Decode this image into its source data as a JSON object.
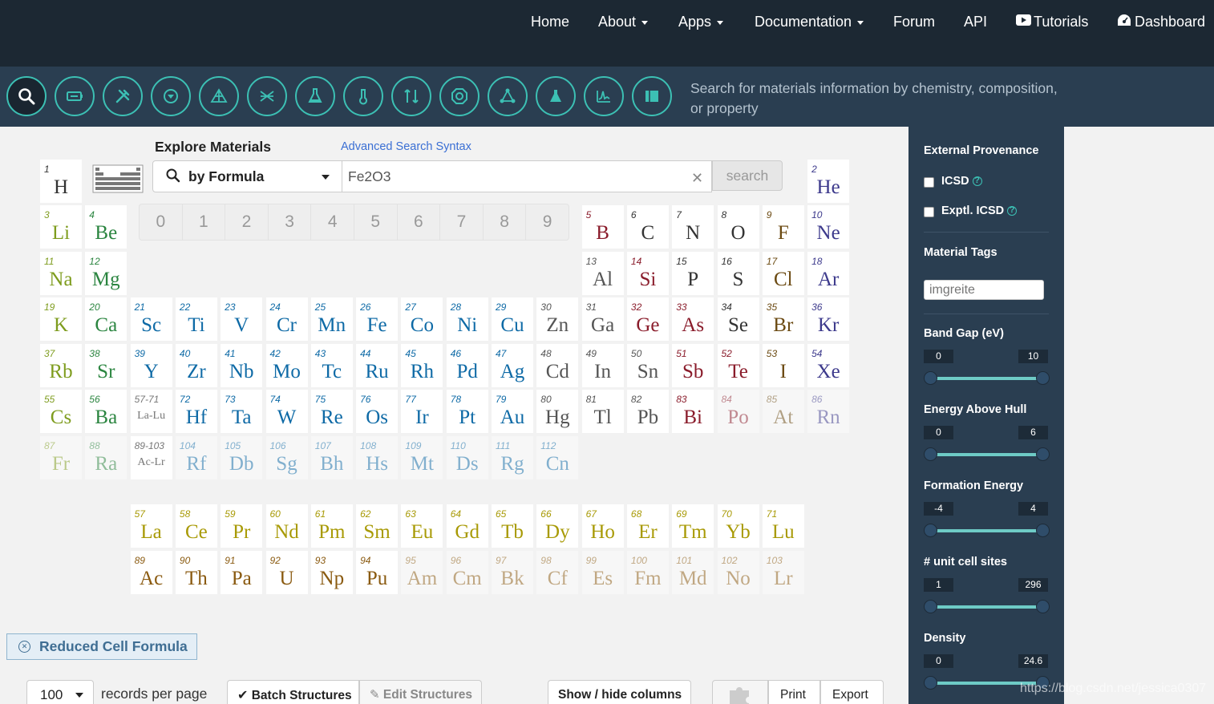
{
  "nav": {
    "home": "Home",
    "about": "About",
    "apps": "Apps",
    "documentation": "Documentation",
    "forum": "Forum",
    "api": "API",
    "tutorials": "Tutorials",
    "dashboard": "Dashboard"
  },
  "toolbar": {
    "tagline": "Search for materials information by chemistry, composition, or property",
    "icons": [
      "search-icon",
      "battery-icon",
      "tools-icon",
      "pourquoi-icon",
      "phase-diagram-icon",
      "crystal-icon",
      "flask-icon",
      "thermometer-icon",
      "reaction-icon",
      "nanoparticle-icon",
      "molecule-icon",
      "chemistry-icon",
      "spectrum-icon",
      "database-icon"
    ]
  },
  "search": {
    "heading": "Explore Materials",
    "advanced_link": "Advanced Search Syntax",
    "mode": "by Formula",
    "value": "Fe2O3",
    "button": "search",
    "digits": [
      "0",
      "1",
      "2",
      "3",
      "4",
      "5",
      "6",
      "7",
      "8",
      "9"
    ]
  },
  "periodic_table": {
    "elements": [
      {
        "n": "1",
        "s": "H",
        "c": "nonmetal",
        "g": 1,
        "p": 1
      },
      {
        "n": "2",
        "s": "He",
        "c": "noble",
        "g": 18,
        "p": 1
      },
      {
        "n": "3",
        "s": "Li",
        "c": "alkali",
        "g": 1,
        "p": 2
      },
      {
        "n": "4",
        "s": "Be",
        "c": "alkaline",
        "g": 2,
        "p": 2
      },
      {
        "n": "5",
        "s": "B",
        "c": "metalloid",
        "g": 13,
        "p": 2
      },
      {
        "n": "6",
        "s": "C",
        "c": "nonmetal",
        "g": 14,
        "p": 2
      },
      {
        "n": "7",
        "s": "N",
        "c": "nonmetal",
        "g": 15,
        "p": 2
      },
      {
        "n": "8",
        "s": "O",
        "c": "nonmetal",
        "g": 16,
        "p": 2
      },
      {
        "n": "9",
        "s": "F",
        "c": "halogen",
        "g": 17,
        "p": 2
      },
      {
        "n": "10",
        "s": "Ne",
        "c": "noble",
        "g": 18,
        "p": 2
      },
      {
        "n": "11",
        "s": "Na",
        "c": "alkali",
        "g": 1,
        "p": 3
      },
      {
        "n": "12",
        "s": "Mg",
        "c": "alkaline",
        "g": 2,
        "p": 3
      },
      {
        "n": "13",
        "s": "Al",
        "c": "post",
        "g": 13,
        "p": 3
      },
      {
        "n": "14",
        "s": "Si",
        "c": "metalloid",
        "g": 14,
        "p": 3
      },
      {
        "n": "15",
        "s": "P",
        "c": "nonmetal",
        "g": 15,
        "p": 3
      },
      {
        "n": "16",
        "s": "S",
        "c": "nonmetal",
        "g": 16,
        "p": 3
      },
      {
        "n": "17",
        "s": "Cl",
        "c": "halogen",
        "g": 17,
        "p": 3
      },
      {
        "n": "18",
        "s": "Ar",
        "c": "noble",
        "g": 18,
        "p": 3
      },
      {
        "n": "19",
        "s": "K",
        "c": "alkali",
        "g": 1,
        "p": 4
      },
      {
        "n": "20",
        "s": "Ca",
        "c": "alkaline",
        "g": 2,
        "p": 4
      },
      {
        "n": "21",
        "s": "Sc",
        "c": "transition",
        "g": 3,
        "p": 4
      },
      {
        "n": "22",
        "s": "Ti",
        "c": "transition",
        "g": 4,
        "p": 4
      },
      {
        "n": "23",
        "s": "V",
        "c": "transition",
        "g": 5,
        "p": 4
      },
      {
        "n": "24",
        "s": "Cr",
        "c": "transition",
        "g": 6,
        "p": 4
      },
      {
        "n": "25",
        "s": "Mn",
        "c": "transition",
        "g": 7,
        "p": 4
      },
      {
        "n": "26",
        "s": "Fe",
        "c": "transition",
        "g": 8,
        "p": 4
      },
      {
        "n": "27",
        "s": "Co",
        "c": "transition",
        "g": 9,
        "p": 4
      },
      {
        "n": "28",
        "s": "Ni",
        "c": "transition",
        "g": 10,
        "p": 4
      },
      {
        "n": "29",
        "s": "Cu",
        "c": "transition",
        "g": 11,
        "p": 4
      },
      {
        "n": "30",
        "s": "Zn",
        "c": "post",
        "g": 12,
        "p": 4
      },
      {
        "n": "31",
        "s": "Ga",
        "c": "post",
        "g": 13,
        "p": 4
      },
      {
        "n": "32",
        "s": "Ge",
        "c": "metalloid",
        "g": 14,
        "p": 4
      },
      {
        "n": "33",
        "s": "As",
        "c": "metalloid",
        "g": 15,
        "p": 4
      },
      {
        "n": "34",
        "s": "Se",
        "c": "nonmetal",
        "g": 16,
        "p": 4
      },
      {
        "n": "35",
        "s": "Br",
        "c": "halogen",
        "g": 17,
        "p": 4
      },
      {
        "n": "36",
        "s": "Kr",
        "c": "noble",
        "g": 18,
        "p": 4
      },
      {
        "n": "37",
        "s": "Rb",
        "c": "alkali",
        "g": 1,
        "p": 5
      },
      {
        "n": "38",
        "s": "Sr",
        "c": "alkaline",
        "g": 2,
        "p": 5
      },
      {
        "n": "39",
        "s": "Y",
        "c": "transition",
        "g": 3,
        "p": 5
      },
      {
        "n": "40",
        "s": "Zr",
        "c": "transition",
        "g": 4,
        "p": 5
      },
      {
        "n": "41",
        "s": "Nb",
        "c": "transition",
        "g": 5,
        "p": 5
      },
      {
        "n": "42",
        "s": "Mo",
        "c": "transition",
        "g": 6,
        "p": 5
      },
      {
        "n": "43",
        "s": "Tc",
        "c": "transition",
        "g": 7,
        "p": 5
      },
      {
        "n": "44",
        "s": "Ru",
        "c": "transition",
        "g": 8,
        "p": 5
      },
      {
        "n": "45",
        "s": "Rh",
        "c": "transition",
        "g": 9,
        "p": 5
      },
      {
        "n": "46",
        "s": "Pd",
        "c": "transition",
        "g": 10,
        "p": 5
      },
      {
        "n": "47",
        "s": "Ag",
        "c": "transition",
        "g": 11,
        "p": 5
      },
      {
        "n": "48",
        "s": "Cd",
        "c": "post",
        "g": 12,
        "p": 5
      },
      {
        "n": "49",
        "s": "In",
        "c": "post",
        "g": 13,
        "p": 5
      },
      {
        "n": "50",
        "s": "Sn",
        "c": "post",
        "g": 14,
        "p": 5
      },
      {
        "n": "51",
        "s": "Sb",
        "c": "metalloid",
        "g": 15,
        "p": 5
      },
      {
        "n": "52",
        "s": "Te",
        "c": "metalloid",
        "g": 16,
        "p": 5
      },
      {
        "n": "53",
        "s": "I",
        "c": "halogen",
        "g": 17,
        "p": 5
      },
      {
        "n": "54",
        "s": "Xe",
        "c": "noble",
        "g": 18,
        "p": 5
      },
      {
        "n": "55",
        "s": "Cs",
        "c": "alkali",
        "g": 1,
        "p": 6
      },
      {
        "n": "56",
        "s": "Ba",
        "c": "alkaline",
        "g": 2,
        "p": 6
      },
      {
        "n": "57-71",
        "s": "La-Lu",
        "c": "range",
        "g": 3,
        "p": 6
      },
      {
        "n": "72",
        "s": "Hf",
        "c": "transition",
        "g": 4,
        "p": 6
      },
      {
        "n": "73",
        "s": "Ta",
        "c": "transition",
        "g": 5,
        "p": 6
      },
      {
        "n": "74",
        "s": "W",
        "c": "transition",
        "g": 6,
        "p": 6
      },
      {
        "n": "75",
        "s": "Re",
        "c": "transition",
        "g": 7,
        "p": 6
      },
      {
        "n": "76",
        "s": "Os",
        "c": "transition",
        "g": 8,
        "p": 6
      },
      {
        "n": "77",
        "s": "Ir",
        "c": "transition",
        "g": 9,
        "p": 6
      },
      {
        "n": "78",
        "s": "Pt",
        "c": "transition",
        "g": 10,
        "p": 6
      },
      {
        "n": "79",
        "s": "Au",
        "c": "transition",
        "g": 11,
        "p": 6
      },
      {
        "n": "80",
        "s": "Hg",
        "c": "post",
        "g": 12,
        "p": 6
      },
      {
        "n": "81",
        "s": "Tl",
        "c": "post",
        "g": 13,
        "p": 6
      },
      {
        "n": "82",
        "s": "Pb",
        "c": "post",
        "g": 14,
        "p": 6
      },
      {
        "n": "83",
        "s": "Bi",
        "c": "metalloid",
        "g": 15,
        "p": 6
      },
      {
        "n": "84",
        "s": "Po",
        "c": "metalloid",
        "g": 16,
        "p": 6,
        "dim": true
      },
      {
        "n": "85",
        "s": "At",
        "c": "halogen",
        "g": 17,
        "p": 6,
        "dim": true
      },
      {
        "n": "86",
        "s": "Rn",
        "c": "noble",
        "g": 18,
        "p": 6,
        "dim": true
      },
      {
        "n": "87",
        "s": "Fr",
        "c": "alkali",
        "g": 1,
        "p": 7,
        "dim": true
      },
      {
        "n": "88",
        "s": "Ra",
        "c": "alkaline",
        "g": 2,
        "p": 7,
        "dim": true
      },
      {
        "n": "89-103",
        "s": "Ac-Lr",
        "c": "range",
        "g": 3,
        "p": 7
      },
      {
        "n": "104",
        "s": "Rf",
        "c": "transition",
        "g": 4,
        "p": 7,
        "dim": true
      },
      {
        "n": "105",
        "s": "Db",
        "c": "transition",
        "g": 5,
        "p": 7,
        "dim": true
      },
      {
        "n": "106",
        "s": "Sg",
        "c": "transition",
        "g": 6,
        "p": 7,
        "dim": true
      },
      {
        "n": "107",
        "s": "Bh",
        "c": "transition",
        "g": 7,
        "p": 7,
        "dim": true
      },
      {
        "n": "108",
        "s": "Hs",
        "c": "transition",
        "g": 8,
        "p": 7,
        "dim": true
      },
      {
        "n": "109",
        "s": "Mt",
        "c": "transition",
        "g": 9,
        "p": 7,
        "dim": true
      },
      {
        "n": "110",
        "s": "Ds",
        "c": "transition",
        "g": 10,
        "p": 7,
        "dim": true
      },
      {
        "n": "111",
        "s": "Rg",
        "c": "transition",
        "g": 11,
        "p": 7,
        "dim": true
      },
      {
        "n": "112",
        "s": "Cn",
        "c": "transition",
        "g": 12,
        "p": 7,
        "dim": true
      },
      {
        "n": "57",
        "s": "La",
        "c": "lanthanide",
        "g": 3,
        "p": 9
      },
      {
        "n": "58",
        "s": "Ce",
        "c": "lanthanide",
        "g": 4,
        "p": 9
      },
      {
        "n": "59",
        "s": "Pr",
        "c": "lanthanide",
        "g": 5,
        "p": 9
      },
      {
        "n": "60",
        "s": "Nd",
        "c": "lanthanide",
        "g": 6,
        "p": 9
      },
      {
        "n": "61",
        "s": "Pm",
        "c": "lanthanide",
        "g": 7,
        "p": 9
      },
      {
        "n": "62",
        "s": "Sm",
        "c": "lanthanide",
        "g": 8,
        "p": 9
      },
      {
        "n": "63",
        "s": "Eu",
        "c": "lanthanide",
        "g": 9,
        "p": 9
      },
      {
        "n": "64",
        "s": "Gd",
        "c": "lanthanide",
        "g": 10,
        "p": 9
      },
      {
        "n": "65",
        "s": "Tb",
        "c": "lanthanide",
        "g": 11,
        "p": 9
      },
      {
        "n": "66",
        "s": "Dy",
        "c": "lanthanide",
        "g": 12,
        "p": 9
      },
      {
        "n": "67",
        "s": "Ho",
        "c": "lanthanide",
        "g": 13,
        "p": 9
      },
      {
        "n": "68",
        "s": "Er",
        "c": "lanthanide",
        "g": 14,
        "p": 9
      },
      {
        "n": "69",
        "s": "Tm",
        "c": "lanthanide",
        "g": 15,
        "p": 9
      },
      {
        "n": "70",
        "s": "Yb",
        "c": "lanthanide",
        "g": 16,
        "p": 9
      },
      {
        "n": "71",
        "s": "Lu",
        "c": "lanthanide",
        "g": 17,
        "p": 9
      },
      {
        "n": "89",
        "s": "Ac",
        "c": "actinide",
        "g": 3,
        "p": 10
      },
      {
        "n": "90",
        "s": "Th",
        "c": "actinide",
        "g": 4,
        "p": 10
      },
      {
        "n": "91",
        "s": "Pa",
        "c": "actinide",
        "g": 5,
        "p": 10
      },
      {
        "n": "92",
        "s": "U",
        "c": "actinide",
        "g": 6,
        "p": 10
      },
      {
        "n": "93",
        "s": "Np",
        "c": "actinide",
        "g": 7,
        "p": 10
      },
      {
        "n": "94",
        "s": "Pu",
        "c": "actinide",
        "g": 8,
        "p": 10
      },
      {
        "n": "95",
        "s": "Am",
        "c": "actinide",
        "g": 9,
        "p": 10,
        "dim": true
      },
      {
        "n": "96",
        "s": "Cm",
        "c": "actinide",
        "g": 10,
        "p": 10,
        "dim": true
      },
      {
        "n": "97",
        "s": "Bk",
        "c": "actinide",
        "g": 11,
        "p": 10,
        "dim": true
      },
      {
        "n": "98",
        "s": "Cf",
        "c": "actinide",
        "g": 12,
        "p": 10,
        "dim": true
      },
      {
        "n": "99",
        "s": "Es",
        "c": "actinide",
        "g": 13,
        "p": 10,
        "dim": true
      },
      {
        "n": "100",
        "s": "Fm",
        "c": "actinide",
        "g": 14,
        "p": 10,
        "dim": true
      },
      {
        "n": "101",
        "s": "Md",
        "c": "actinide",
        "g": 15,
        "p": 10,
        "dim": true
      },
      {
        "n": "102",
        "s": "No",
        "c": "actinide",
        "g": 16,
        "p": 10,
        "dim": true
      },
      {
        "n": "103",
        "s": "Lr",
        "c": "actinide",
        "g": 17,
        "p": 10,
        "dim": true
      }
    ],
    "colors": {
      "alkali": "#7e9c1e",
      "alkaline": "#2b8540",
      "transition": "#0e6aa6",
      "post": "#555555",
      "metalloid": "#8a1c2b",
      "nonmetal": "#333333",
      "halogen": "#6b4a12",
      "noble": "#3d3a8c",
      "lanthanide": "#a89a06",
      "actinide": "#8a5a10",
      "range": "#777777"
    }
  },
  "results_bar": {
    "chip": "Reduced Cell Formula",
    "per_page_value": "100",
    "per_page_label": "records per page",
    "batch": "Batch Structures",
    "edit": "Edit Structures",
    "columns": "Show / hide columns",
    "print": "Print",
    "export": "Export"
  },
  "sidebar": {
    "external_provenance": "External Provenance",
    "icsd": "ICSD",
    "exptl_icsd": "Exptl. ICSD",
    "material_tags": "Material Tags",
    "tags_placeholder": "imgreite",
    "sliders": [
      {
        "label": "Band Gap (eV)",
        "min": "0",
        "max": "10"
      },
      {
        "label": "Energy Above Hull",
        "min": "0",
        "max": "6"
      },
      {
        "label": "Formation Energy",
        "min": "-4",
        "max": "4"
      },
      {
        "label": "# unit cell sites",
        "min": "1",
        "max": "296"
      },
      {
        "label": "Density",
        "min": "0",
        "max": "24.6"
      }
    ]
  },
  "watermark": "https://blog.csdn.net/jessica0307"
}
